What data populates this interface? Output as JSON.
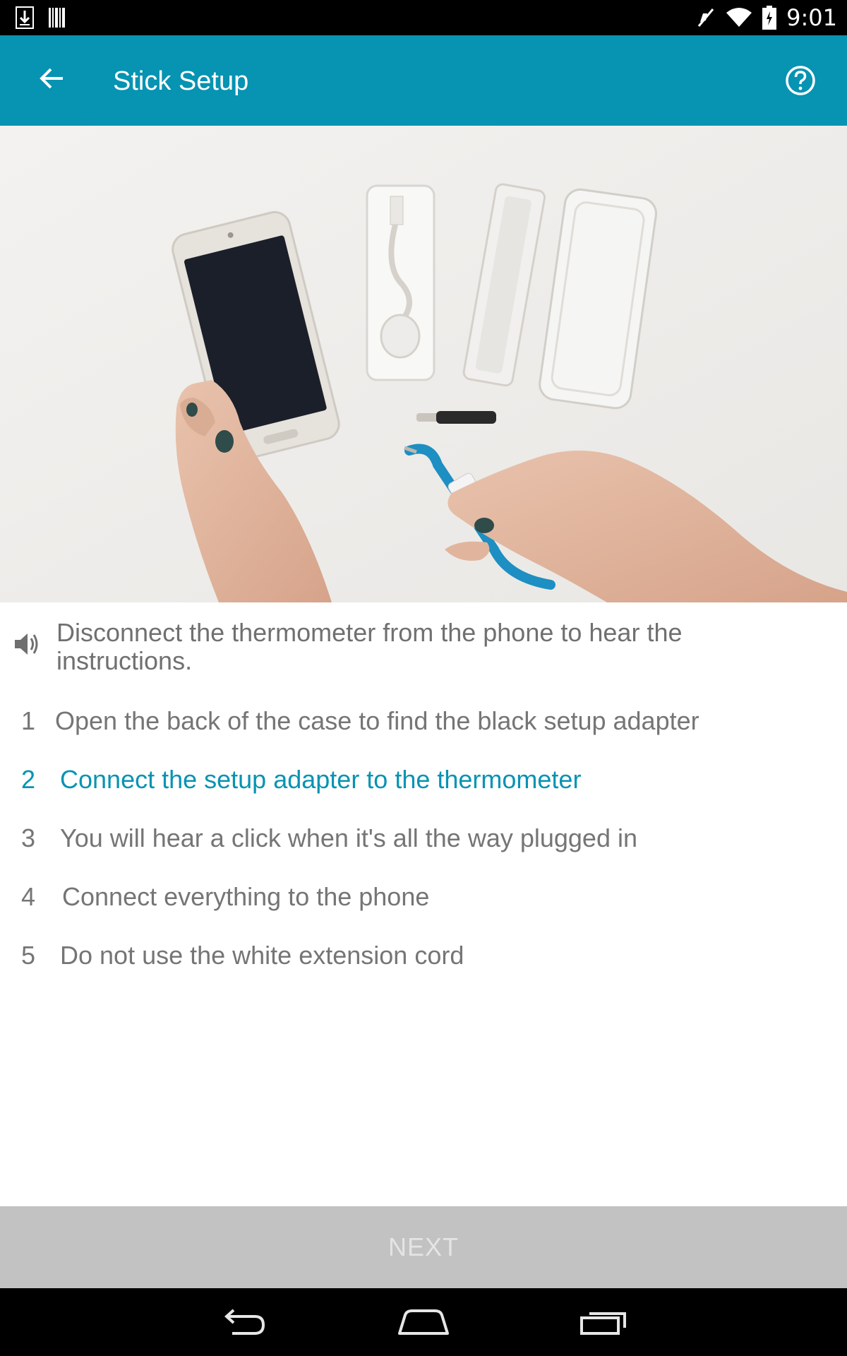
{
  "status_bar": {
    "time": "9:01",
    "icons": [
      "download-icon",
      "barcode-icon",
      "vibrate-mute-icon",
      "wifi-icon",
      "battery-charging-icon"
    ]
  },
  "app_bar": {
    "title": "Stick Setup",
    "back_icon": "arrow-back-icon",
    "help_icon": "help-circle-icon"
  },
  "media": {
    "description_icon": "setup-video-frame"
  },
  "audio_note": {
    "text": "Disconnect the thermometer from the phone to hear the instructions.",
    "icon": "speaker-icon"
  },
  "steps": [
    {
      "num": "1",
      "text": "Open the back of the case to find the black setup adapter",
      "active": false
    },
    {
      "num": "2",
      "text": "Connect the setup adapter to the thermometer",
      "active": true
    },
    {
      "num": "3",
      "text": "You will hear a click when it's all the way plugged in",
      "active": false
    },
    {
      "num": "4",
      "text": "Connect everything to the phone",
      "active": false
    },
    {
      "num": "5",
      "text": "Do not use the white extension cord",
      "active": false
    }
  ],
  "next_button": {
    "label": "NEXT",
    "enabled": false
  },
  "colors": {
    "accent": "#0793b2",
    "text_gray": "#757575",
    "next_bg_disabled": "#c2c2c2"
  },
  "nav_bar": {
    "icons": [
      "nav-back-icon",
      "nav-home-icon",
      "nav-recents-icon"
    ]
  }
}
